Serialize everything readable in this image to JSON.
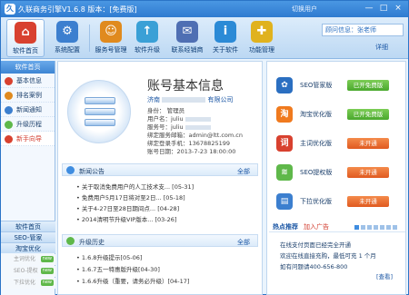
{
  "window": {
    "title": "久联商务引擎V1.6.8 版本：[免费版]",
    "login_label": "切换用户",
    "min": "—",
    "max": "□",
    "close": "×"
  },
  "toolbar": {
    "items": [
      {
        "label": "软件首页",
        "icon": "home-icon",
        "color": "#d8412f",
        "glyph": "⌂"
      },
      {
        "label": "系统配置",
        "icon": "gear-icon",
        "color": "#3c7fcf",
        "glyph": "⚙"
      },
      {
        "label": "服务号管理",
        "icon": "users-icon",
        "color": "#e08a1e",
        "glyph": "☺"
      },
      {
        "label": "软件升级",
        "icon": "upgrade-icon",
        "color": "#3aa0d6",
        "glyph": "↑"
      },
      {
        "label": "联系经销商",
        "icon": "contact-icon",
        "color": "#4f6fb3",
        "glyph": "✉"
      },
      {
        "label": "关于软件",
        "icon": "info-icon",
        "color": "#2b8ad6",
        "glyph": "i"
      },
      {
        "label": "功能管理",
        "icon": "puzzle-icon",
        "color": "#e0b21e",
        "glyph": "✚"
      }
    ],
    "user_box": "顾问信息：张老师",
    "detail_link": "详细"
  },
  "sidebar": {
    "header": "软件首页",
    "items": [
      {
        "label": "基本信息",
        "color": "#d8412f",
        "selected": false
      },
      {
        "label": "排名案例",
        "color": "#e08a1e",
        "selected": false
      },
      {
        "label": "新闻通知",
        "color": "#3c7fcf",
        "selected": false
      },
      {
        "label": "升级历程",
        "color": "#5fb84a",
        "selected": false
      },
      {
        "label": "新手向导",
        "color": "#d8412f",
        "selected": true
      }
    ],
    "groups": [
      "软件首页",
      "SEO-管家",
      "淘宝优化"
    ],
    "subs": [
      {
        "label": "主词优化",
        "tag": "new"
      },
      {
        "label": "SEO-提权",
        "tag": "new"
      },
      {
        "label": "下拉优化",
        "tag": "new"
      }
    ]
  },
  "account": {
    "title": "账号基本信息",
    "company": "济南",
    "company_suffix": "有限公司",
    "lines": [
      "身份：  管理员",
      "用户名：juliu",
      "服务号：juliu",
      "绑定服务邮箱：admin@ltt.com.cn",
      "绑定登录手机：13678825199",
      "账号日期：2013-7-23 18:00:00"
    ]
  },
  "news": {
    "title": "新闻公告",
    "all": "全部",
    "items": [
      "• 关于取消免费用户的人工技术支... [05-31]",
      "• 免费用户5月17日将对至2日... [05-18]",
      "• 关于4-27日至28日期间点... [04-28]",
      "• 2014清明节升级VIP版本... [03-26]"
    ]
  },
  "upgrades": {
    "title": "升级历史",
    "all": "全部",
    "items": [
      "• 1.6.8升级提示[05-06]",
      "• 1.6.7五一特惠版升级[04-30]",
      "• 1.6.6升级（重要，请务必升级）[04-17]"
    ]
  },
  "tools": [
    {
      "name": "SEO管家版",
      "status": "已开免费版",
      "state": "on",
      "icon": "paw-icon",
      "color": "#2b6fc1",
      "glyph": "✿"
    },
    {
      "name": "淘宝优化版",
      "status": "已开免费版",
      "state": "on",
      "icon": "taobao-icon",
      "color": "#f07a1e",
      "glyph": "淘"
    },
    {
      "name": "主词优化版",
      "status": "未开通",
      "state": "off",
      "icon": "keyword-icon",
      "color": "#d8412f",
      "glyph": "词"
    },
    {
      "name": "SEO提权版",
      "status": "未开通",
      "state": "off",
      "icon": "signal-icon",
      "color": "#5fb84a",
      "glyph": "≋"
    },
    {
      "name": "下拉优化版",
      "status": "未开通",
      "state": "off",
      "icon": "dropdown-icon",
      "color": "#3c7fcf",
      "glyph": "▤"
    }
  ],
  "hot": {
    "title": "热点推荐",
    "join": "加入广告",
    "lines": [
      "在线支付页面已经完全开通",
      "欢迎在线直接充购，最低可充 1 个月",
      "如有问题请400-656-800"
    ],
    "view": "[查看]"
  }
}
